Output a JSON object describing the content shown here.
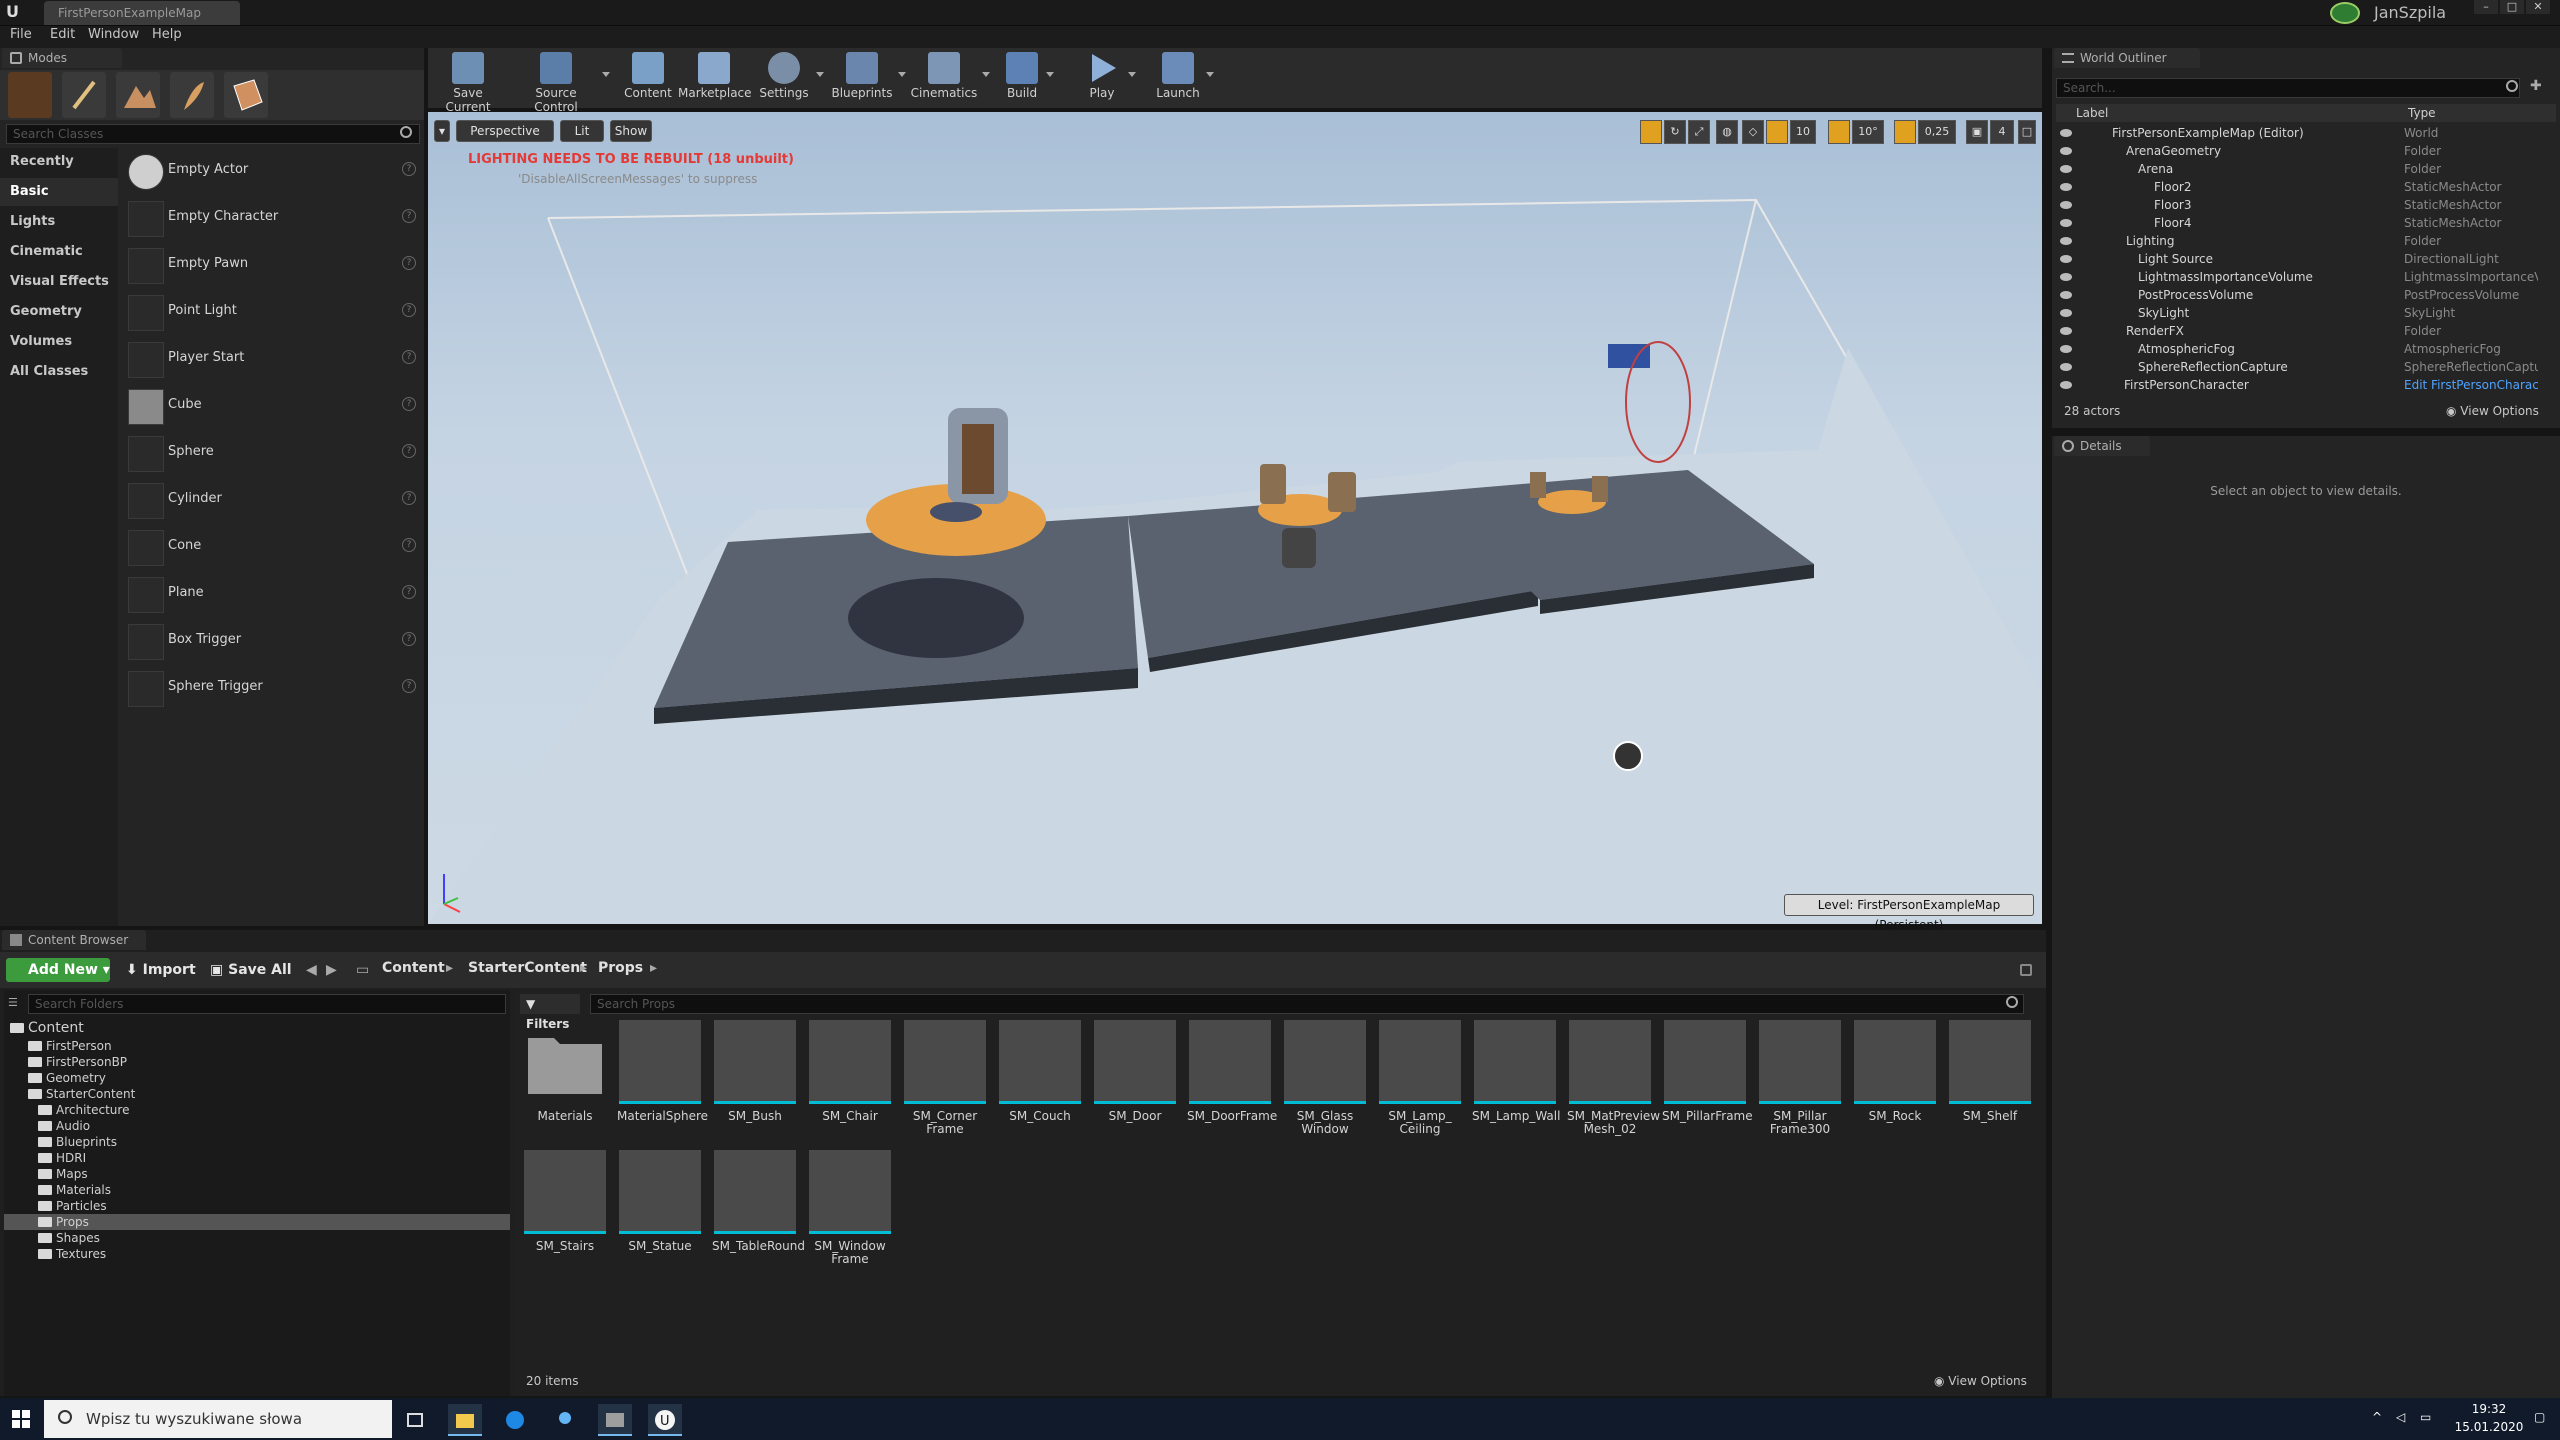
{
  "window": {
    "tab_title": "FirstPersonExampleMap",
    "user_name": "JanSzpila"
  },
  "menu": [
    "File",
    "Edit",
    "Window",
    "Help"
  ],
  "modes": {
    "tab_label": "Modes",
    "search_placeholder": "Search Classes",
    "categories": [
      "Recently Placed",
      "Basic",
      "Lights",
      "Cinematic",
      "Visual Effects",
      "Geometry",
      "Volumes",
      "All Classes"
    ],
    "active_category": "Basic",
    "items": [
      "Empty Actor",
      "Empty Character",
      "Empty Pawn",
      "Point Light",
      "Player Start",
      "Cube",
      "Sphere",
      "Cylinder",
      "Cone",
      "Plane",
      "Box Trigger",
      "Sphere Trigger"
    ]
  },
  "toolbar": {
    "buttons": [
      "Save Current",
      "Source Control",
      "Content",
      "Marketplace",
      "Settings",
      "Blueprints",
      "Cinematics",
      "Build",
      "Play",
      "Launch"
    ]
  },
  "viewport": {
    "perspective_label": "Perspective",
    "lit_label": "Lit",
    "show_label": "Show",
    "warning": "LIGHTING NEEDS TO BE REBUILT (18 unbuilt)",
    "suppress_hint": "'DisableAllScreenMessages' to suppress",
    "grid_snap": "10",
    "rotation_snap": "10°",
    "scale_snap": "0,25",
    "camera_speed": "4",
    "level_label": "Level:  FirstPersonExampleMap (Persistent)"
  },
  "outliner": {
    "tab_label": "World Outliner",
    "search_placeholder": "Search...",
    "col_label": "Label",
    "col_type": "Type",
    "rows": [
      {
        "label": "FirstPersonExampleMap (Editor)",
        "type": "World"
      },
      {
        "label": "ArenaGeometry",
        "type": "Folder"
      },
      {
        "label": "Arena",
        "type": "Folder"
      },
      {
        "label": "Floor2",
        "type": "StaticMeshActor"
      },
      {
        "label": "Floor3",
        "type": "StaticMeshActor"
      },
      {
        "label": "Floor4",
        "type": "StaticMeshActor"
      },
      {
        "label": "Lighting",
        "type": "Folder"
      },
      {
        "label": "Light Source",
        "type": "DirectionalLight"
      },
      {
        "label": "LightmassImportanceVolume",
        "type": "LightmassImportanceVo"
      },
      {
        "label": "PostProcessVolume",
        "type": "PostProcessVolume"
      },
      {
        "label": "SkyLight",
        "type": "SkyLight"
      },
      {
        "label": "RenderFX",
        "type": "Folder"
      },
      {
        "label": "AtmosphericFog",
        "type": "AtmosphericFog"
      },
      {
        "label": "SphereReflectionCapture",
        "type": "SphereReflectionCapture"
      },
      {
        "label": "FirstPersonCharacter",
        "type": "Edit FirstPersonCharac"
      }
    ],
    "actor_count": "28 actors",
    "view_options": "View Options"
  },
  "details": {
    "tab_label": "Details",
    "hint": "Select an object to view details."
  },
  "content_browser": {
    "tab_label": "Content Browser",
    "add_new": "Add New",
    "import": "Import",
    "save_all": "Save All",
    "breadcrumb": [
      "Content",
      "StarterContent",
      "Props"
    ],
    "search_folders": "Search Folders",
    "filters": "Filters",
    "search_props": "Search Props",
    "folders": [
      {
        "name": "Content",
        "depth": 0
      },
      {
        "name": "FirstPerson",
        "depth": 1
      },
      {
        "name": "FirstPersonBP",
        "depth": 1
      },
      {
        "name": "Geometry",
        "depth": 1
      },
      {
        "name": "StarterContent",
        "depth": 1
      },
      {
        "name": "Architecture",
        "depth": 2
      },
      {
        "name": "Audio",
        "depth": 2
      },
      {
        "name": "Blueprints",
        "depth": 2
      },
      {
        "name": "HDRI",
        "depth": 2
      },
      {
        "name": "Maps",
        "depth": 2
      },
      {
        "name": "Materials",
        "depth": 2
      },
      {
        "name": "Particles",
        "depth": 2
      },
      {
        "name": "Props",
        "depth": 2
      },
      {
        "name": "Shapes",
        "depth": 2
      },
      {
        "name": "Textures",
        "depth": 2
      }
    ],
    "assets": [
      "Materials",
      "MaterialSphere",
      "SM_Bush",
      "SM_Chair",
      "SM_Corner Frame",
      "SM_Couch",
      "SM_Door",
      "SM_DoorFrame",
      "SM_Glass Window",
      "SM_Lamp_ Ceiling",
      "SM_Lamp_Wall",
      "SM_MatPreview Mesh_02",
      "SM_PillarFrame",
      "SM_Pillar Frame300",
      "SM_Rock",
      "SM_Shelf",
      "SM_Stairs",
      "SM_Statue",
      "SM_TableRound",
      "SM_Window Frame"
    ],
    "item_count": "20 items",
    "view_options": "View Options"
  },
  "taskbar": {
    "search_placeholder": "Wpisz tu wyszukiwane słowa",
    "time": "19:32",
    "date": "15.01.2020"
  }
}
